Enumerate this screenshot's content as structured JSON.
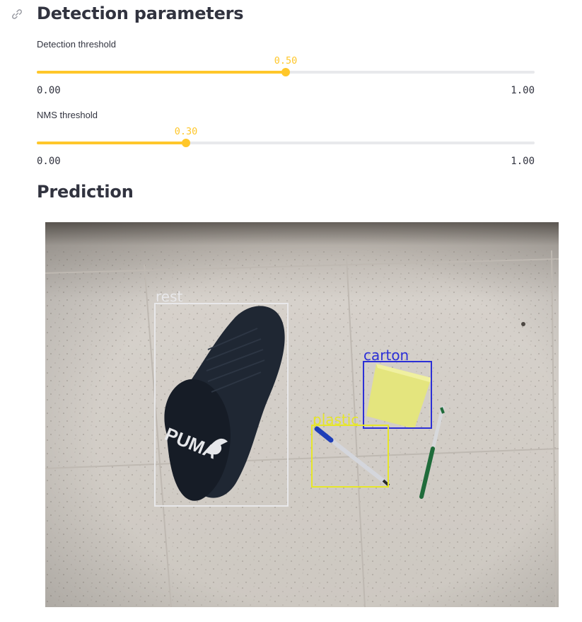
{
  "sections": {
    "detection_title": "Detection parameters",
    "prediction_title": "Prediction"
  },
  "sliders": {
    "detection": {
      "label": "Detection threshold",
      "value": 0.5,
      "value_text": "0.50",
      "min_text": "0.00",
      "max_text": "1.00"
    },
    "nms": {
      "label": "NMS threshold",
      "value": 0.3,
      "value_text": "0.30",
      "min_text": "0.00",
      "max_text": "1.00"
    }
  },
  "prediction": {
    "labels": {
      "rest": "rest",
      "carton": "carton",
      "plastic": "plastic"
    },
    "box_colors": {
      "rest": "#e8e8ea",
      "carton": "#2b2fd6",
      "plastic": "#e6e62a"
    }
  },
  "colors": {
    "accent": "#ffc72a",
    "text": "#31333f"
  },
  "icons": {
    "section_anchor": "link-icon"
  }
}
